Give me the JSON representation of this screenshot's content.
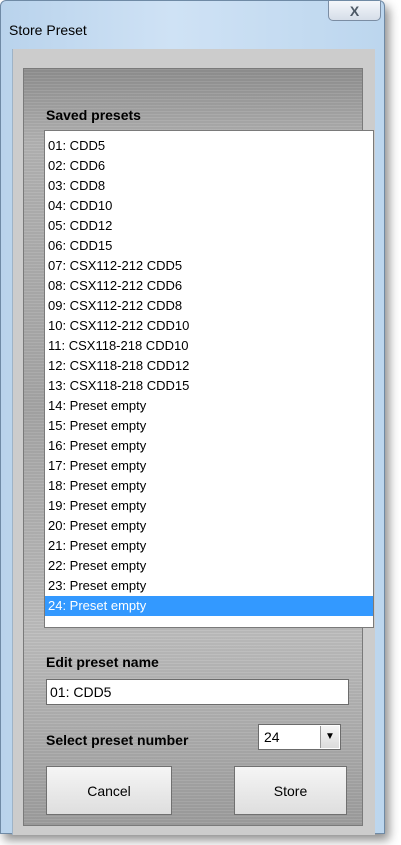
{
  "window": {
    "title": "Store Preset",
    "close_glyph": "X"
  },
  "saved_presets": {
    "label": "Saved presets",
    "items": [
      "01: CDD5",
      "02: CDD6",
      "03: CDD8",
      "04: CDD10",
      "05: CDD12",
      "06: CDD15",
      "07: CSX112-212 CDD5",
      "08: CSX112-212 CDD6",
      "09: CSX112-212 CDD8",
      "10: CSX112-212 CDD10",
      "11: CSX118-218 CDD10",
      "12: CSX118-218 CDD12",
      "13: CSX118-218 CDD15",
      "14: Preset empty",
      "15: Preset empty",
      "16: Preset empty",
      "17: Preset empty",
      "18: Preset empty",
      "19: Preset empty",
      "20: Preset empty",
      "21: Preset empty",
      "22: Preset empty",
      "23: Preset empty",
      "24: Preset empty"
    ],
    "selected_index": 23
  },
  "edit_name": {
    "label": "Edit preset name",
    "value": "01: CDD5"
  },
  "preset_number": {
    "label": "Select preset number",
    "value": "24"
  },
  "buttons": {
    "cancel": "Cancel",
    "store": "Store"
  },
  "colors": {
    "selection": "#3399ff",
    "panel": "#a9a9a9",
    "window_frame": "#c4dbf1"
  }
}
